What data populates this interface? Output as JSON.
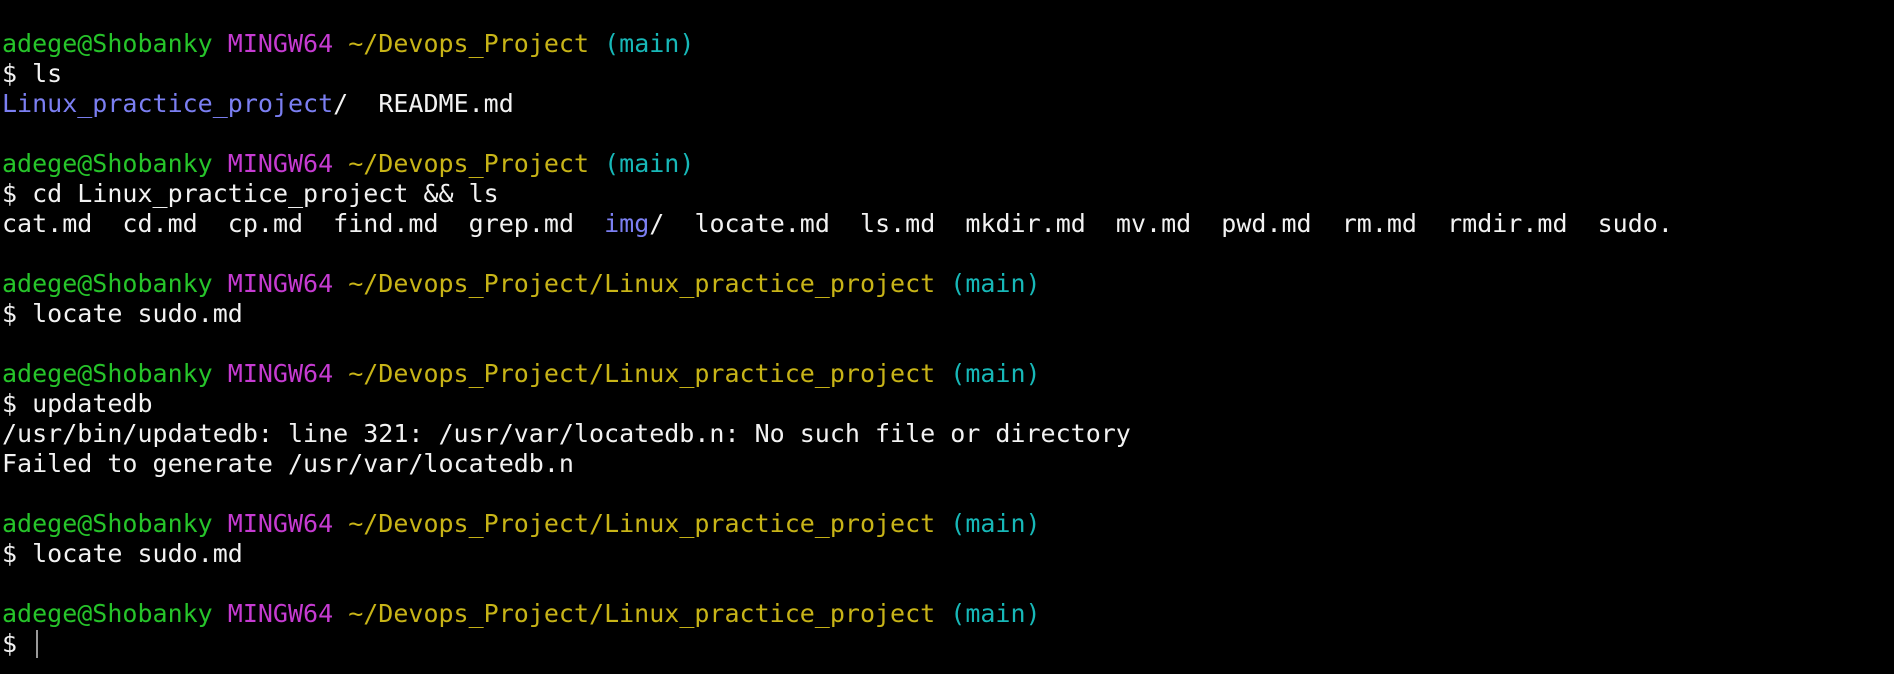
{
  "prompt": {
    "user_host": "adege@Shobanky",
    "shell": "MINGW64",
    "branch": "(main)",
    "symbol": "$"
  },
  "blocks": [
    {
      "path": "~/Devops_Project",
      "command": "ls",
      "output": [
        {
          "type": "ls",
          "entries": [
            {
              "name": "Linux_practice_project",
              "suffix": "/",
              "dir": true,
              "sep": "  "
            },
            {
              "name": "README.md",
              "suffix": "",
              "dir": false,
              "sep": ""
            }
          ]
        }
      ]
    },
    {
      "path": "~/Devops_Project",
      "command": "cd Linux_practice_project && ls",
      "output": [
        {
          "type": "ls",
          "entries": [
            {
              "name": "cat.md",
              "suffix": "",
              "dir": false,
              "sep": "  "
            },
            {
              "name": "cd.md",
              "suffix": "",
              "dir": false,
              "sep": "  "
            },
            {
              "name": "cp.md",
              "suffix": "",
              "dir": false,
              "sep": "  "
            },
            {
              "name": "find.md",
              "suffix": "",
              "dir": false,
              "sep": "  "
            },
            {
              "name": "grep.md",
              "suffix": "",
              "dir": false,
              "sep": "  "
            },
            {
              "name": "img",
              "suffix": "/",
              "dir": true,
              "sep": "  "
            },
            {
              "name": "locate.md",
              "suffix": "",
              "dir": false,
              "sep": "  "
            },
            {
              "name": "ls.md",
              "suffix": "",
              "dir": false,
              "sep": "  "
            },
            {
              "name": "mkdir.md",
              "suffix": "",
              "dir": false,
              "sep": "  "
            },
            {
              "name": "mv.md",
              "suffix": "",
              "dir": false,
              "sep": "  "
            },
            {
              "name": "pwd.md",
              "suffix": "",
              "dir": false,
              "sep": "  "
            },
            {
              "name": "rm.md",
              "suffix": "",
              "dir": false,
              "sep": "  "
            },
            {
              "name": "rmdir.md",
              "suffix": "",
              "dir": false,
              "sep": "  "
            },
            {
              "name": "sudo.",
              "suffix": "",
              "dir": false,
              "sep": ""
            }
          ]
        }
      ]
    },
    {
      "path": "~/Devops_Project/Linux_practice_project",
      "command": "locate sudo.md",
      "output": []
    },
    {
      "path": "~/Devops_Project/Linux_practice_project",
      "command": "updatedb",
      "output": [
        {
          "type": "text",
          "text": "/usr/bin/updatedb: line 321: /usr/var/locatedb.n: No such file or directory"
        },
        {
          "type": "text",
          "text": "Failed to generate /usr/var/locatedb.n"
        }
      ]
    },
    {
      "path": "~/Devops_Project/Linux_practice_project",
      "command": "locate sudo.md",
      "output": []
    },
    {
      "path": "~/Devops_Project/Linux_practice_project",
      "command": "",
      "output": [],
      "active": true
    }
  ],
  "colors": {
    "background": "#000000",
    "foreground": "#f2f2f2",
    "user": "#26c42a",
    "host": "#c63bd1",
    "path": "#c8b417",
    "branch": "#17b8b8",
    "directory": "#7b7ff2"
  }
}
